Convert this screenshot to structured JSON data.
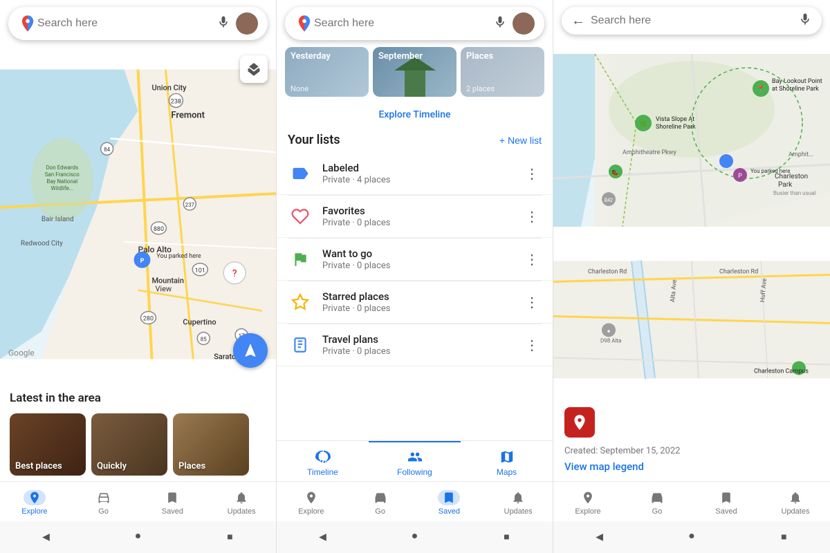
{
  "panels": {
    "left": {
      "search_placeholder": "Search here",
      "latest_title": "Latest in the area",
      "cards": [
        {
          "label": "Best places",
          "bg": "#5a3e2b"
        },
        {
          "label": "Quickly",
          "bg": "#6b4c2e"
        },
        {
          "label": "Places",
          "bg": "#8b6340"
        }
      ],
      "bottom_nav": [
        {
          "id": "explore",
          "label": "Explore",
          "active": true
        },
        {
          "id": "go",
          "label": "Go",
          "active": false
        },
        {
          "id": "saved",
          "label": "Saved",
          "active": false
        },
        {
          "id": "updates",
          "label": "Updates",
          "active": false
        }
      ]
    },
    "middle": {
      "search_placeholder": "Search here",
      "timeline_thumbs": [
        {
          "top_label": "Yesterday",
          "bottom_label": "None",
          "bg": "#a0b4c8"
        },
        {
          "top_label": "September",
          "bottom_label": "",
          "bg": "#7a9ab0"
        },
        {
          "top_label": "Places",
          "bottom_label": "2 places",
          "bg": "#9aafbf"
        }
      ],
      "explore_timeline_label": "Explore Timeline",
      "your_lists_title": "Your lists",
      "new_list_label": "+ New list",
      "lists": [
        {
          "name": "Labeled",
          "meta": "Private · 4 places",
          "icon": "🅿",
          "icon_color": "#4285F4"
        },
        {
          "name": "Favorites",
          "meta": "Private · 0 places",
          "icon": "♡",
          "icon_color": "#e8536a"
        },
        {
          "name": "Want to go",
          "meta": "Private · 0 places",
          "icon": "⚑",
          "icon_color": "#4caf50"
        },
        {
          "name": "Starred places",
          "meta": "Private · 0 places",
          "icon": "☆",
          "icon_color": "#f4b400"
        },
        {
          "name": "Travel plans",
          "meta": "Private · 0 places",
          "icon": "🧳",
          "icon_color": "#4285F4"
        }
      ],
      "tabs": [
        {
          "id": "timeline",
          "label": "Timeline"
        },
        {
          "id": "following",
          "label": "Following"
        },
        {
          "id": "maps",
          "label": "Maps"
        }
      ],
      "bottom_nav": [
        {
          "id": "explore",
          "label": "Explore",
          "active": false
        },
        {
          "id": "go",
          "label": "Go",
          "active": false
        },
        {
          "id": "saved",
          "label": "Saved",
          "active": true
        },
        {
          "id": "updates",
          "label": "Updates",
          "active": false
        }
      ]
    },
    "right": {
      "search_placeholder": "Search here",
      "map_info": {
        "created_label": "Created: September 15, 2022",
        "view_legend_label": "View map legend"
      },
      "bottom_nav": [
        {
          "id": "explore",
          "label": "Explore",
          "active": false
        },
        {
          "id": "go",
          "label": "Go",
          "active": false
        },
        {
          "id": "saved",
          "label": "Saved",
          "active": false
        },
        {
          "id": "updates",
          "label": "Updates",
          "active": false
        }
      ]
    }
  },
  "system_nav": {
    "back": "◀",
    "home": "●",
    "recents": "■"
  },
  "map_labels": {
    "union_city": "Union City",
    "fremont": "Fremont",
    "bair_island": "Bair Island",
    "redwood_city": "Redwood City",
    "palo_alto": "Palo Alto",
    "mountain_view": "Mountain View",
    "cupertino": "Cupertino",
    "saratoga": "Saratoga",
    "google": "Google",
    "you_parked_here": "You parked here",
    "bay_lookout": "Bay Lookout Point at Shoreline Park",
    "vista_slope": "Vista Slope At Shoreline Park",
    "charlston_park": "Charleston Park",
    "busier_than_usual": "Busier than usual",
    "charleston_rd": "Charleston Rd",
    "charleston_campus": "Charleston Campus",
    "amphitheatre_pkwy": "Amphitheatre Pkwy"
  }
}
